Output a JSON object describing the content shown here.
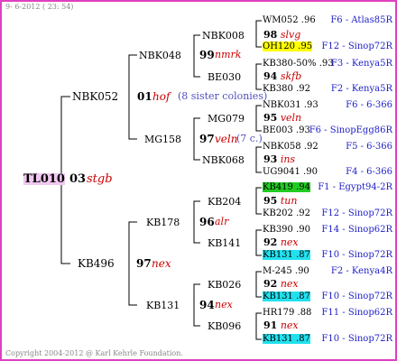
{
  "header_date": "9- 6-2012 ( 23: 54)",
  "footer": "Copyright 2004-2012 @ Karl Kehrle Foundation.",
  "root": {
    "id": "TL010",
    "num": "03",
    "name": "stgb"
  },
  "gen1": [
    {
      "id": "NBK052"
    },
    {
      "id": "KB496",
      "num": "97",
      "name": "nex"
    }
  ],
  "gen2": [
    {
      "id": "NBK048",
      "num": "01",
      "name": "hof",
      "note": "(8 sister colonies)"
    },
    {
      "id": "MG158",
      "num": "97",
      "name": "veln",
      "note": "(7 c.)"
    },
    {
      "id": "KB178",
      "num": "96",
      "name": "alr"
    },
    {
      "id": "KB131",
      "num": "94",
      "name": "nex"
    }
  ],
  "gen3": [
    {
      "id": "NBK008",
      "num": "99",
      "name": "nmrk"
    },
    {
      "id": "BE030"
    },
    {
      "id": "MG079",
      "num": "95",
      "name": "veln"
    },
    {
      "id": "NBK068",
      "num": "93",
      "name": "ins"
    },
    {
      "id": "KB204",
      "num": "95",
      "name": "tun"
    },
    {
      "id": "KB141",
      "num": "92",
      "name": "nex"
    },
    {
      "id": "KB026",
      "num": "92",
      "name": "nex"
    },
    {
      "id": "KB096",
      "num": "91",
      "name": "nex"
    }
  ],
  "gen3_extra": {
    "nbk008_line": "98 slvg",
    "be030_line": "94 skfb"
  },
  "gen4": [
    {
      "id": "WM052",
      "score": ".96",
      "origin": "F6 - Atlas85R"
    },
    {
      "id": "OH120",
      "score": ".95",
      "origin": "F12 - Sinop72R"
    },
    {
      "id": "KB380-50%",
      "score": ".93",
      "origin": "F3 - Kenya5R"
    },
    {
      "id": "KB380",
      "score": ".92",
      "origin": "F2 - Kenya5R"
    },
    {
      "id": "NBK031",
      "score": ".93",
      "origin": "F6 - 6-366"
    },
    {
      "id": "BE003",
      "score": ".93",
      "origin": "F6 - SinopEgg86R"
    },
    {
      "id": "NBK058",
      "score": ".92",
      "origin": "F5 - 6-366"
    },
    {
      "id": "UG9041",
      "score": ".90",
      "origin": "F4 - 6-366"
    },
    {
      "id": "KB419",
      "score": ".94",
      "origin": "F1 - Egypt94-2R"
    },
    {
      "id": "KB202",
      "score": ".92",
      "origin": "F12 - Sinop72R"
    },
    {
      "id": "KB390",
      "score": ".90",
      "origin": "F14 - Sinop62R"
    },
    {
      "id": "KB131",
      "score": ".87",
      "origin": "F10 - Sinop72R"
    },
    {
      "id": "M-245",
      "score": ".90",
      "origin": "F2 - Kenya4R"
    },
    {
      "id": "KB131",
      "score": ".87",
      "origin": "F10 - Sinop72R"
    },
    {
      "id": "HR179",
      "score": ".88",
      "origin": "F11 - Sinop62R"
    },
    {
      "id": "KB131",
      "score": ".87",
      "origin": "F10 - Sinop72R"
    }
  ]
}
